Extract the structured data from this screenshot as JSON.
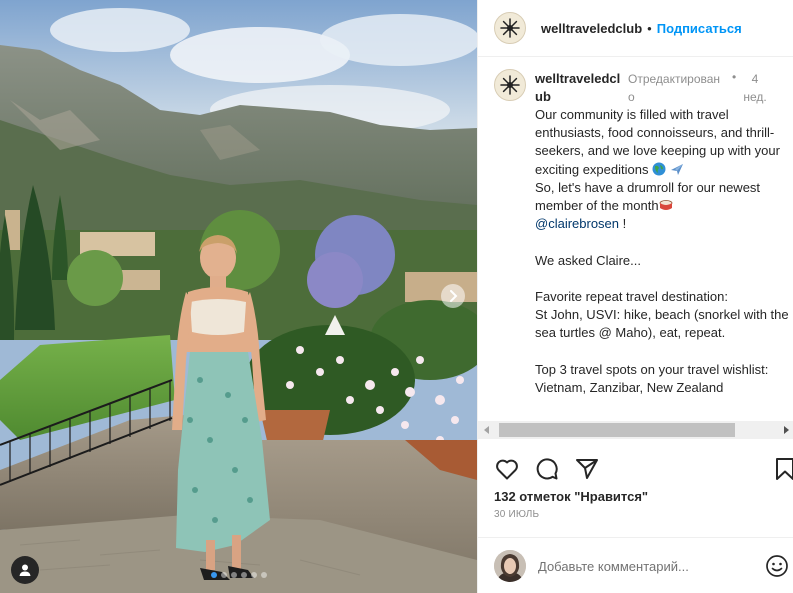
{
  "photo": {
    "carousel_dots": 6,
    "active_dot": 0
  },
  "header": {
    "username": "welltraveledclub",
    "separator": "•",
    "follow_label": "Подписаться"
  },
  "caption": {
    "username": "welltraveledclub",
    "edited": "Отредактировано",
    "separator": "•",
    "time": "4 нед.",
    "line1": "Our community is filled with travel enthusiasts, food connoisseurs, and thrill-seekers, and we love keeping up with your exciting expeditions ",
    "line2": "So, let's have a drumroll for our newest member of the month",
    "mention": "@clairebrosen",
    "mention_suffix": " !",
    "line3": "We asked Claire...",
    "line4": "Favorite repeat travel destination:",
    "line5": "St John, USVI: hike, beach (snorkel with the sea turtles @ Maho), eat, repeat.",
    "line6": "Top 3 travel spots on your travel wishlist:",
    "line7": "Vietnam, Zanzibar, New Zealand"
  },
  "icons": {
    "like": "heart-icon",
    "comment": "comment-icon",
    "share": "paper-plane-icon",
    "save": "bookmark-icon",
    "emoji": "smiley-icon"
  },
  "stats": {
    "likes": "132 отметок \"Нравится\"",
    "date": "30 ИЮЛЬ"
  },
  "comment": {
    "placeholder": "Добавьте комментарий..."
  },
  "colors": {
    "accent": "#0095f6",
    "active_dot": "#3897f0",
    "mention": "#00376b"
  }
}
